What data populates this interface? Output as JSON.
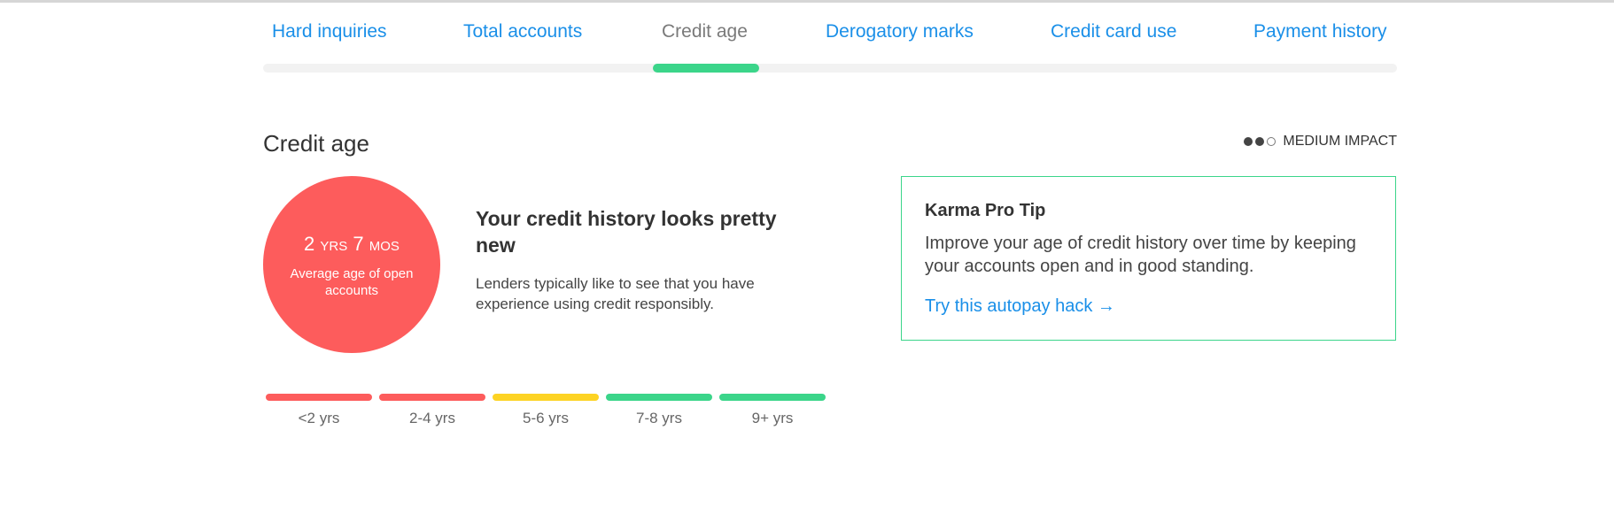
{
  "tabs": [
    {
      "label": "Hard inquiries"
    },
    {
      "label": "Total accounts"
    },
    {
      "label": "Credit age",
      "active": true
    },
    {
      "label": "Derogatory marks"
    },
    {
      "label": "Credit card use"
    },
    {
      "label": "Payment history"
    }
  ],
  "section": {
    "title": "Credit age",
    "impact": {
      "label": "MEDIUM IMPACT",
      "level": 2,
      "max_level": 3
    }
  },
  "summary": {
    "years": "2",
    "years_unit": "YRS",
    "months": "7",
    "months_unit": "MOS",
    "label": "Average age of open accounts",
    "color": "#fd5c5c"
  },
  "message": {
    "title": "Your credit history looks pretty new",
    "body": "Lenders typically like to see that you have experience using credit responsibly."
  },
  "scale": [
    {
      "label": "<2 yrs",
      "color": "#fd5c5c"
    },
    {
      "label": "2-4 yrs",
      "color": "#fd5c5c"
    },
    {
      "label": "5-6 yrs",
      "color": "#fdd323"
    },
    {
      "label": "7-8 yrs",
      "color": "#3bd58a"
    },
    {
      "label": "9+ yrs",
      "color": "#3bd58a"
    }
  ],
  "tip": {
    "title": "Karma Pro Tip",
    "body": "Improve your age of credit history over time by keeping your accounts open and in good standing.",
    "link": "Try this autopay hack →"
  },
  "colors": {
    "accent": "#1a8fe8",
    "active_indicator": "#3bd58a",
    "tip_border": "#3bd58a"
  }
}
